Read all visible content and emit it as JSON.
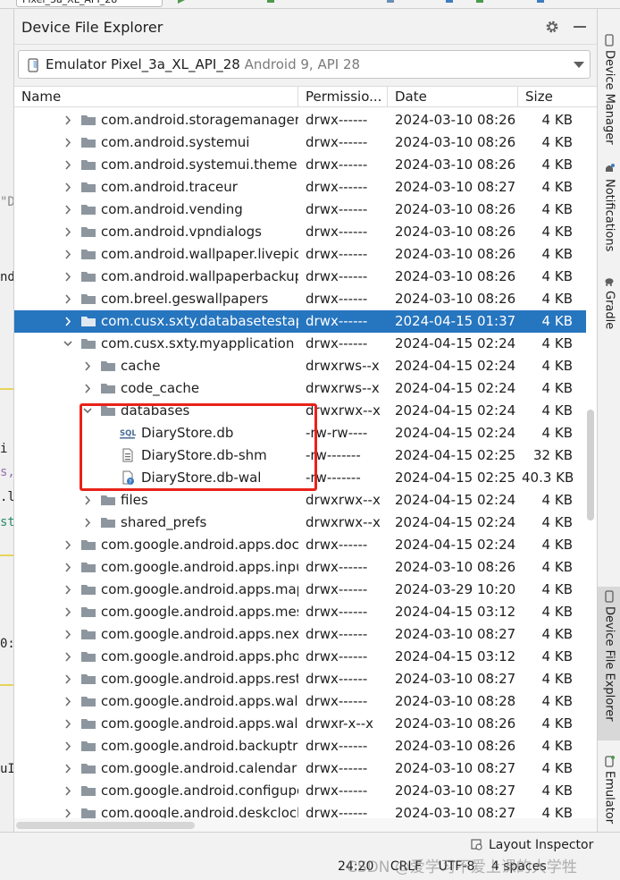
{
  "topbar": {
    "config_label": "Pixel_3a_XL_API_28"
  },
  "left_editor_fragments": [
    "\"D",
    "nd",
    "i",
    "s,",
    ".l",
    "st",
    "0:",
    "uI"
  ],
  "panel": {
    "title": "Device File Explorer",
    "device": {
      "name": "Emulator Pixel_3a_XL_API_28",
      "sub": "Android 9, API 28"
    }
  },
  "columns": [
    "Name",
    "Permissio...",
    "Date",
    "Size"
  ],
  "rows": [
    {
      "name": "com.android.storagemanager",
      "perm": "drwx------",
      "date": "2024-03-10 08:26",
      "size": "4 KB",
      "level": 0,
      "type": "folder",
      "expand": "collapsed"
    },
    {
      "name": "com.android.systemui",
      "perm": "drwx------",
      "date": "2024-03-10 08:26",
      "size": "4 KB",
      "level": 0,
      "type": "folder",
      "expand": "collapsed"
    },
    {
      "name": "com.android.systemui.theme.dark",
      "perm": "drwx------",
      "date": "2024-03-10 08:26",
      "size": "4 KB",
      "level": 0,
      "type": "folder",
      "expand": "collapsed"
    },
    {
      "name": "com.android.traceur",
      "perm": "drwx------",
      "date": "2024-03-10 08:27",
      "size": "4 KB",
      "level": 0,
      "type": "folder",
      "expand": "collapsed"
    },
    {
      "name": "com.android.vending",
      "perm": "drwx------",
      "date": "2024-03-10 08:26",
      "size": "4 KB",
      "level": 0,
      "type": "folder",
      "expand": "collapsed"
    },
    {
      "name": "com.android.vpndialogs",
      "perm": "drwx------",
      "date": "2024-03-10 08:26",
      "size": "4 KB",
      "level": 0,
      "type": "folder",
      "expand": "collapsed"
    },
    {
      "name": "com.android.wallpaper.livepicker",
      "perm": "drwx------",
      "date": "2024-03-10 08:26",
      "size": "4 KB",
      "level": 0,
      "type": "folder",
      "expand": "collapsed"
    },
    {
      "name": "com.android.wallpaperbackup",
      "perm": "drwx------",
      "date": "2024-03-10 08:26",
      "size": "4 KB",
      "level": 0,
      "type": "folder",
      "expand": "collapsed"
    },
    {
      "name": "com.breel.geswallpapers",
      "perm": "drwx------",
      "date": "2024-03-10 08:26",
      "size": "4 KB",
      "level": 0,
      "type": "folder",
      "expand": "collapsed"
    },
    {
      "name": "com.cusx.sxty.databasetestapp",
      "perm": "drwx------",
      "date": "2024-04-15 01:37",
      "size": "4 KB",
      "level": 0,
      "type": "folder",
      "expand": "collapsed",
      "selected": true
    },
    {
      "name": "com.cusx.sxty.myapplication",
      "perm": "drwx------",
      "date": "2024-04-15 02:24",
      "size": "4 KB",
      "level": 0,
      "type": "folder",
      "expand": "expanded"
    },
    {
      "name": "cache",
      "perm": "drwxrws--x",
      "date": "2024-04-15 02:24",
      "size": "4 KB",
      "level": 1,
      "type": "folder",
      "expand": "collapsed"
    },
    {
      "name": "code_cache",
      "perm": "drwxrws--x",
      "date": "2024-04-15 02:24",
      "size": "4 KB",
      "level": 1,
      "type": "folder",
      "expand": "collapsed"
    },
    {
      "name": "databases",
      "perm": "drwxrwx--x",
      "date": "2024-04-15 02:24",
      "size": "4 KB",
      "level": 1,
      "type": "folder",
      "expand": "expanded"
    },
    {
      "name": "DiaryStore.db",
      "perm": "-rw-rw----",
      "date": "2024-04-15 02:24",
      "size": "4 KB",
      "level": 2,
      "type": "sql",
      "expand": "none"
    },
    {
      "name": "DiaryStore.db-shm",
      "perm": "-rw-------",
      "date": "2024-04-15 02:25",
      "size": "32 KB",
      "level": 2,
      "type": "file",
      "expand": "none"
    },
    {
      "name": "DiaryStore.db-wal",
      "perm": "-rw-------",
      "date": "2024-04-15 02:25",
      "size": "40.3 KB",
      "level": 2,
      "type": "unknown",
      "expand": "none"
    },
    {
      "name": "files",
      "perm": "drwxrwx--x",
      "date": "2024-04-15 02:24",
      "size": "4 KB",
      "level": 1,
      "type": "folder",
      "expand": "collapsed"
    },
    {
      "name": "shared_prefs",
      "perm": "drwxrwx--x",
      "date": "2024-04-15 02:24",
      "size": "4 KB",
      "level": 1,
      "type": "folder",
      "expand": "collapsed"
    },
    {
      "name": "com.google.android.apps.docs",
      "perm": "drwx------",
      "date": "2024-04-15 02:24",
      "size": "4 KB",
      "level": 0,
      "type": "folder",
      "expand": "collapsed"
    },
    {
      "name": "com.google.android.apps.inputmethod",
      "perm": "drwx------",
      "date": "2024-03-10 08:26",
      "size": "4 KB",
      "level": 0,
      "type": "folder",
      "expand": "collapsed"
    },
    {
      "name": "com.google.android.apps.maps",
      "perm": "drwx------",
      "date": "2024-03-29 10:20",
      "size": "4 KB",
      "level": 0,
      "type": "folder",
      "expand": "collapsed"
    },
    {
      "name": "com.google.android.apps.messaging",
      "perm": "drwx------",
      "date": "2024-04-15 03:12",
      "size": "4 KB",
      "level": 0,
      "type": "folder",
      "expand": "collapsed"
    },
    {
      "name": "com.google.android.apps.nexuslauncher",
      "perm": "drwx------",
      "date": "2024-03-10 08:27",
      "size": "4 KB",
      "level": 0,
      "type": "folder",
      "expand": "collapsed"
    },
    {
      "name": "com.google.android.apps.photos",
      "perm": "drwx------",
      "date": "2024-04-15 03:12",
      "size": "4 KB",
      "level": 0,
      "type": "folder",
      "expand": "collapsed"
    },
    {
      "name": "com.google.android.apps.restore",
      "perm": "drwx------",
      "date": "2024-03-10 08:27",
      "size": "4 KB",
      "level": 0,
      "type": "folder",
      "expand": "collapsed"
    },
    {
      "name": "com.google.android.apps.wallpaper",
      "perm": "drwx------",
      "date": "2024-03-10 08:28",
      "size": "4 KB",
      "level": 0,
      "type": "folder",
      "expand": "collapsed"
    },
    {
      "name": "com.google.android.apps.wallpaper.nexus",
      "perm": "drwxr-x--x",
      "date": "2024-03-10 08:26",
      "size": "4 KB",
      "level": 0,
      "type": "folder",
      "expand": "collapsed"
    },
    {
      "name": "com.google.android.backuptransport",
      "perm": "drwx------",
      "date": "2024-03-10 08:26",
      "size": "4 KB",
      "level": 0,
      "type": "folder",
      "expand": "collapsed"
    },
    {
      "name": "com.google.android.calendar",
      "perm": "drwx------",
      "date": "2024-03-10 08:27",
      "size": "4 KB",
      "level": 0,
      "type": "folder",
      "expand": "collapsed"
    },
    {
      "name": "com.google.android.configupdater",
      "perm": "drwx------",
      "date": "2024-03-10 08:27",
      "size": "4 KB",
      "level": 0,
      "type": "folder",
      "expand": "collapsed"
    },
    {
      "name": "com.google.android.deskclock",
      "perm": "drwx------",
      "date": "2024-03-10 08:27",
      "size": "4 KB",
      "level": 0,
      "type": "folder",
      "expand": "collapsed"
    }
  ],
  "right_tools": [
    "Device Manager",
    "Notifications",
    "Gradle",
    "Device File Explorer",
    "Emulator"
  ],
  "status": {
    "layout_inspector": "Layout Inspector",
    "items": [
      "24:20",
      "CRLF",
      "UTF-8",
      "4 spaces"
    ],
    "watermark": "CSDN @爱学习不爱上课的大学牲"
  },
  "colors": {
    "selection": "#2675bf",
    "annotation": "#e8221a",
    "folder": "#8d969e"
  }
}
